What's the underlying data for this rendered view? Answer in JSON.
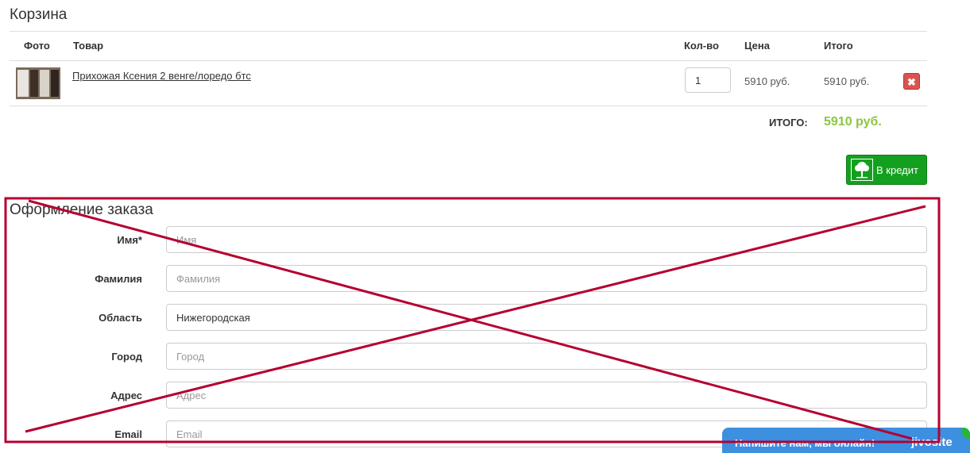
{
  "cart": {
    "title": "Корзина",
    "columns": {
      "photo": "Фото",
      "product": "Товар",
      "qty": "Кол-во",
      "price": "Цена",
      "total": "Итого"
    },
    "items": [
      {
        "name": "Прихожая Ксения 2 венге/лоредо бтс",
        "qty": "1",
        "price": "5910 руб.",
        "total": "5910 руб.",
        "delete_icon": "close-icon"
      }
    ],
    "summary_label": "ИТОГО:",
    "summary_value": "5910 руб.",
    "credit_button": "В кредит",
    "credit_icon": "tree-icon"
  },
  "order": {
    "title": "Оформление заказа",
    "fields": [
      {
        "label": "Имя*",
        "placeholder": "Имя",
        "value": ""
      },
      {
        "label": "Фамилия",
        "placeholder": "Фамилия",
        "value": ""
      },
      {
        "label": "Область",
        "placeholder": "",
        "value": "Нижегородская"
      },
      {
        "label": "Город",
        "placeholder": "Город",
        "value": ""
      },
      {
        "label": "Адрес",
        "placeholder": "Адрес",
        "value": ""
      },
      {
        "label": "Email",
        "placeholder": "Email",
        "value": ""
      }
    ]
  },
  "chat": {
    "message": "Напишите нам, мы онлайн!",
    "brand": "jivosite"
  },
  "colors": {
    "total_green": "#8cc63f",
    "credit_green": "#14a01f",
    "delete_red": "#d9534f",
    "annotation_red": "#b5002f",
    "chat_blue": "#3d8fe0"
  }
}
